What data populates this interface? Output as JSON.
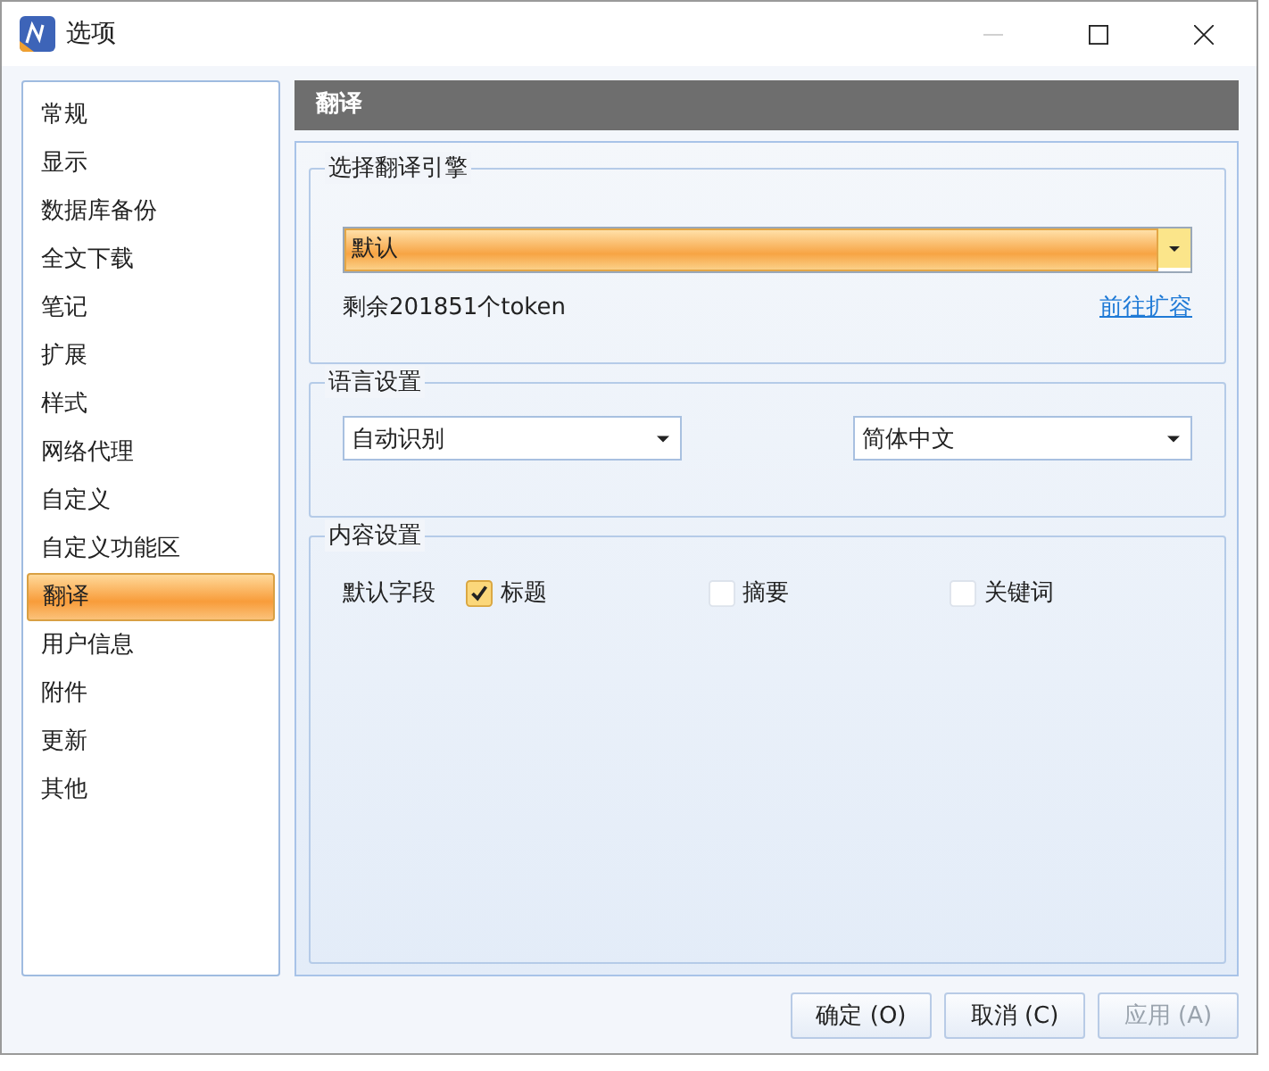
{
  "window": {
    "title": "选项"
  },
  "sidebar": {
    "items": [
      {
        "label": "常规",
        "selected": false
      },
      {
        "label": "显示",
        "selected": false
      },
      {
        "label": "数据库备份",
        "selected": false
      },
      {
        "label": "全文下载",
        "selected": false
      },
      {
        "label": "笔记",
        "selected": false
      },
      {
        "label": "扩展",
        "selected": false
      },
      {
        "label": "样式",
        "selected": false
      },
      {
        "label": "网络代理",
        "selected": false
      },
      {
        "label": "自定义",
        "selected": false
      },
      {
        "label": "自定义功能区",
        "selected": false
      },
      {
        "label": "翻译",
        "selected": true
      },
      {
        "label": "用户信息",
        "selected": false
      },
      {
        "label": "附件",
        "selected": false
      },
      {
        "label": "更新",
        "selected": false
      },
      {
        "label": "其他",
        "selected": false
      }
    ]
  },
  "panel": {
    "title": "翻译",
    "engine_group": {
      "title": "选择翻译引擎",
      "engine": "默认",
      "remaining": "剩余201851个token",
      "link": "前往扩容"
    },
    "language_group": {
      "title": "语言设置",
      "source": "自动识别",
      "target": "简体中文"
    },
    "content_group": {
      "title": "内容设置",
      "label": "默认字段",
      "fields": [
        {
          "label": "标题",
          "checked": true
        },
        {
          "label": "摘要",
          "checked": false
        },
        {
          "label": "关键词",
          "checked": false
        }
      ]
    }
  },
  "buttons": [
    {
      "label": "确定 (O)",
      "disabled": false
    },
    {
      "label": "取消 (C)",
      "disabled": false
    },
    {
      "label": "应用 (A)",
      "disabled": true
    }
  ]
}
